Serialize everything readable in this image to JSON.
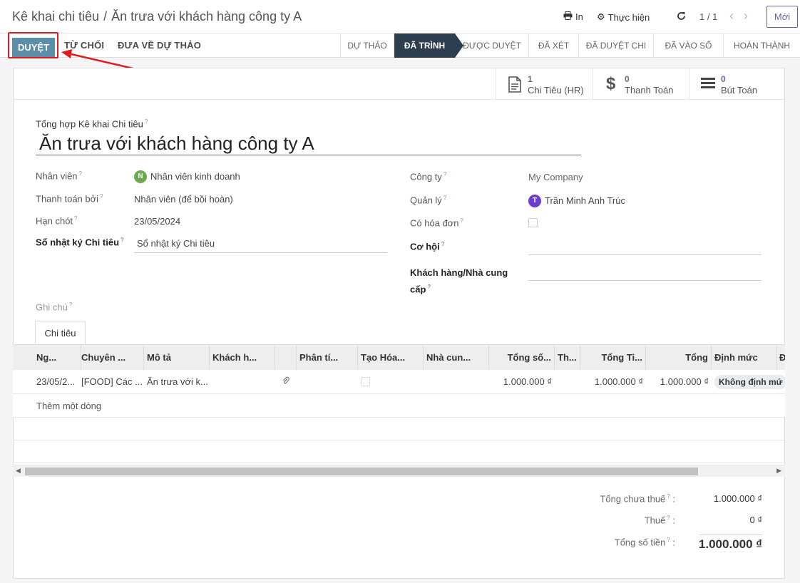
{
  "header": {
    "breadcrumb_parent": "Kê khai chi tiêu",
    "breadcrumb_separator": "/",
    "breadcrumb_current": "Ăn trưa với khách hàng công ty A",
    "print_label": "In",
    "action_label": "Thực hiện",
    "pager": "1 / 1",
    "new_button": "Mới"
  },
  "statusbar": {
    "approve_label": "DUYỆT",
    "refuse_label": "TỪ CHỐI",
    "reset_label": "ĐƯA VỀ DỰ THẢO",
    "stages": [
      "DỰ THẢO",
      "ĐÃ TRÌNH",
      "ĐƯỢC DUYỆT",
      "ĐÃ XÉT",
      "ĐÃ DUYỆT CHI",
      "ĐÃ VÀO SỔ",
      "HOÀN THÀNH"
    ],
    "current_stage": "ĐÃ TRÌNH"
  },
  "smart_buttons": [
    {
      "icon": "document-icon",
      "glyph": "🗎",
      "value": "1",
      "label": "Chi Tiêu (HR)"
    },
    {
      "icon": "dollar-icon",
      "glyph": "$",
      "value": "0",
      "label": "Thanh Toán"
    },
    {
      "icon": "list-icon",
      "glyph": "☰",
      "value": "0",
      "label": "Bút Toán"
    }
  ],
  "form": {
    "title_label": "Tổng hợp Kê khai Chi tiêu",
    "help_mark": "?",
    "title": "Ăn trưa với khách hàng công ty A",
    "employee_label": "Nhân viên",
    "employee_value": "Nhân viên kinh doanh",
    "employee_initial": "N",
    "paid_by_label": "Thanh toán bởi",
    "paid_by_value": "Nhân viên (để bồi hoàn)",
    "deadline_label": "Hạn chót",
    "deadline_value": "23/05/2024",
    "journal_label": "Sổ nhật ký Chi tiêu",
    "journal_value": "Sổ nhật ký Chi tiêu",
    "company_label": "Công ty",
    "company_value": "My Company",
    "manager_label": "Quản lý",
    "manager_value": "Trần Minh Anh Trúc",
    "manager_initial": "T",
    "invoice_label": "Có hóa đơn",
    "opportunity_label": "Cơ hội",
    "partner_label_1": "Khách hàng/Nhà cung",
    "partner_label_2": "cấp",
    "notes_label": "Ghi chú"
  },
  "tab": {
    "label": "Chi tiêu"
  },
  "table": {
    "columns": [
      "Ng...",
      "Chuyên ...",
      "Mô tả",
      "Khách h...",
      "",
      "Phân tí...",
      "Tạo Hóa...",
      "Nhà cun...",
      "Tổng số...",
      "Th...",
      "Tổng Ti...",
      "Tổng",
      "Định mức",
      "Đ"
    ],
    "row": {
      "date": "23/05/2...",
      "category": "[FOOD] Các ...",
      "description": "Ăn trưa với k...",
      "amount": "1.000.000 ₫",
      "total_currency": "1.000.000 ₫",
      "total": "1.000.000 ₫",
      "norm": "Không định mứ"
    },
    "add_line": "Thêm một dòng"
  },
  "totals": {
    "untaxed_label": "Tổng chưa thuế",
    "untaxed_value": "1.000.000 ₫",
    "tax_label": "Thuế",
    "tax_value": "0 ₫",
    "total_label": "Tổng số tiền",
    "total_value": "1.000.000 ₫",
    "colon": ":"
  },
  "colors": {
    "brand": "#71639e",
    "approve": "#5b8fa8",
    "current_stage": "#2c3e50",
    "annotation": "#e0191d"
  }
}
